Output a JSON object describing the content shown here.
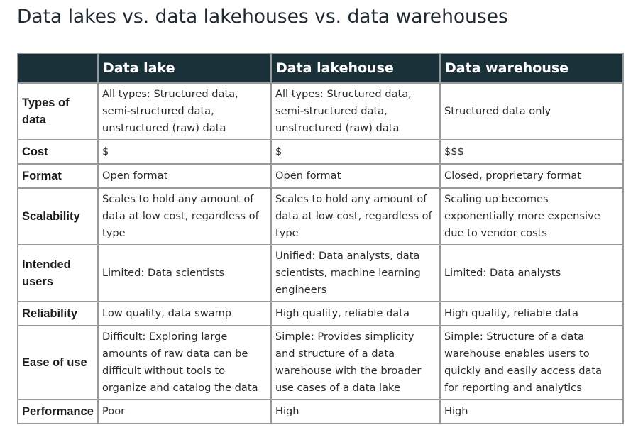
{
  "title": "Data lakes vs. data lakehouses vs. data warehouses",
  "table": {
    "columns": [
      "",
      "Data lake",
      "Data lakehouse",
      "Data warehouse"
    ],
    "rows": [
      {
        "label": "Types of data",
        "cells": [
          "All types: Structured data, semi-structured data, unstructured (raw) data",
          "All types: Structured data, semi-structured data, unstructured (raw) data",
          "Structured data only"
        ]
      },
      {
        "label": "Cost",
        "cells": [
          "$",
          "$",
          "$$$"
        ]
      },
      {
        "label": "Format",
        "cells": [
          "Open format",
          "Open format",
          "Closed, proprietary format"
        ]
      },
      {
        "label": "Scalability",
        "cells": [
          "Scales to hold any amount of data at low cost, regardless of type",
          "Scales to hold any amount of data at low cost, regardless of type",
          "Scaling up becomes exponentially more expensive due to vendor costs"
        ]
      },
      {
        "label": "Intended users",
        "cells": [
          "Limited: Data scientists",
          "Unified: Data analysts, data scientists, machine learning engineers",
          "Limited: Data analysts"
        ]
      },
      {
        "label": "Reliability",
        "cells": [
          "Low quality, data swamp",
          "High quality, reliable data",
          "High quality, reliable data"
        ]
      },
      {
        "label": "Ease of use",
        "cells": [
          "Difficult: Exploring large amounts of raw data can be difficult without tools to organize and catalog the data",
          "Simple: Provides simplicity and structure of a data warehouse with the broader use cases of a data lake",
          "Simple: Structure of a data warehouse enables users to quickly and easily access data for reporting and analytics"
        ]
      },
      {
        "label": "Performance",
        "cells": [
          "Poor",
          "High",
          "High"
        ]
      }
    ]
  },
  "colors": {
    "header_bg": "#1b3139",
    "header_text": "#ffffff",
    "border": "#999999",
    "title_text": "#1f2a30"
  }
}
